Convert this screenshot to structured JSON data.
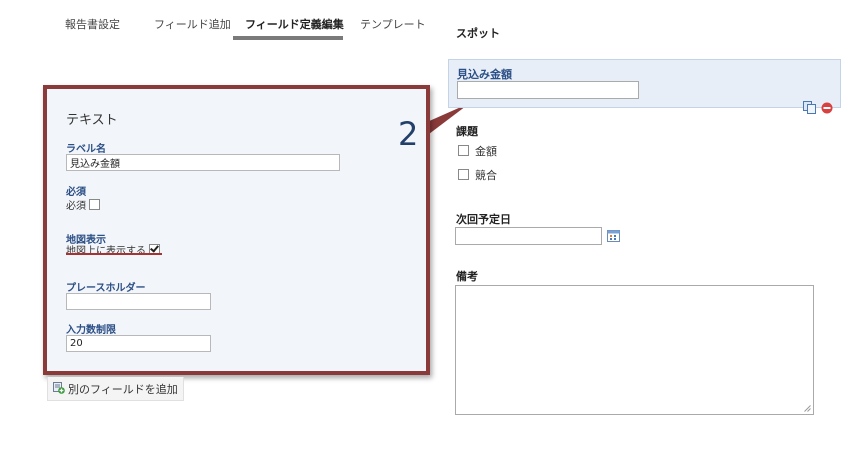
{
  "tabs": [
    {
      "label": "報告書設定",
      "active": false
    },
    {
      "label": "フィールド追加",
      "active": false
    },
    {
      "label": "フィールド定義編集",
      "active": true
    },
    {
      "label": "テンプレート",
      "active": false
    }
  ],
  "editor": {
    "title": "テキスト",
    "step_number": "2",
    "label_name": {
      "label": "ラベル名",
      "value": "見込み金額"
    },
    "required": {
      "label": "必須",
      "option_text": "必須",
      "checked": false
    },
    "map_display": {
      "label": "地図表示",
      "option_text": "地図上に表示する",
      "checked": true
    },
    "placeholder": {
      "label": "プレースホルダー",
      "value": ""
    },
    "max_length": {
      "label": "入力数制限",
      "value": "20"
    }
  },
  "add_field_button": {
    "label": "別のフィールドを追加"
  },
  "preview": {
    "title": "スポット",
    "selected_field": {
      "label": "見込み金額",
      "value": ""
    },
    "issue": {
      "label": "課題",
      "options": [
        {
          "label": "金額",
          "checked": false
        },
        {
          "label": "競合",
          "checked": false
        }
      ]
    },
    "next_date": {
      "label": "次回予定日",
      "value": ""
    },
    "notes": {
      "label": "備考",
      "value": ""
    }
  },
  "colors": {
    "accent_label": "#2b4f87",
    "panel_border": "#8b3a3a",
    "selected_field_bg": "#e8eef7"
  },
  "icons": [
    "copy-icon",
    "delete-icon",
    "calendar-icon",
    "add-field-icon",
    "resize-handle-icon"
  ]
}
